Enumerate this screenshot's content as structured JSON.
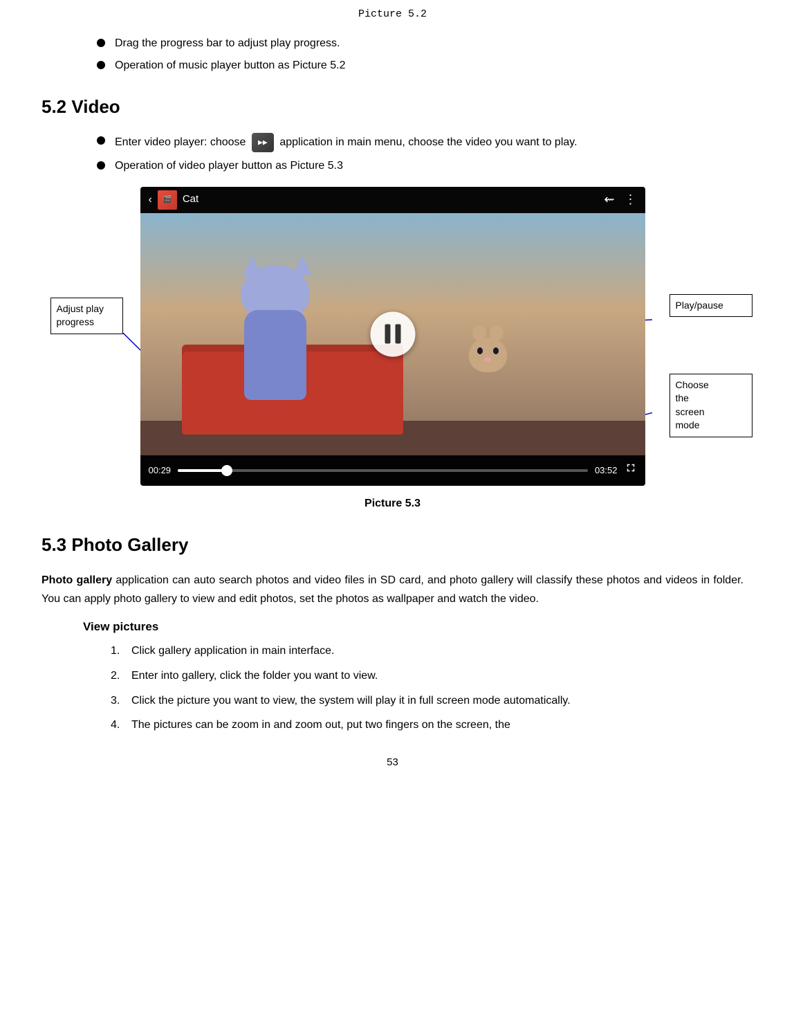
{
  "picture52_label": "Picture 5.2",
  "section52": {
    "heading": "5.2 Video",
    "bullets": [
      "Drag the progress bar to adjust play progress.",
      "Operation of music player button as Picture 5.2"
    ],
    "video_bullets": [
      {
        "text_before": "Enter video player: choose ",
        "text_after": "application in main menu, choose the video you want to play."
      },
      {
        "text": "Operation of video player button as Picture 5.3"
      }
    ],
    "player": {
      "title": "Cat",
      "time_current": "00:29",
      "time_total": "03:52",
      "progress_percent": 12
    },
    "annotations": {
      "left": "Adjust play progress",
      "right_top": "Play/pause",
      "right_bottom_lines": [
        "Choose",
        "the",
        "screen",
        "mode"
      ]
    },
    "picture53_label": "Picture 5.3"
  },
  "section53": {
    "heading": "5.3 Photo Gallery",
    "intro": "Photo gallery application can auto search photos and video files in SD card, and photo gallery will classify these photos and videos in folder. You can apply photo gallery to view and edit photos, set the photos as wallpaper and watch the video.",
    "bold_word": "Photo gallery",
    "view_pictures_heading": "View pictures",
    "steps": [
      "Click gallery application in main interface.",
      "Enter into gallery, click the folder you want to view.",
      "Click the picture you want to view, the system will play it in full screen mode automatically.",
      "The pictures can be zoom in and zoom out, put two fingers on the screen, the"
    ]
  },
  "page_number": "53"
}
